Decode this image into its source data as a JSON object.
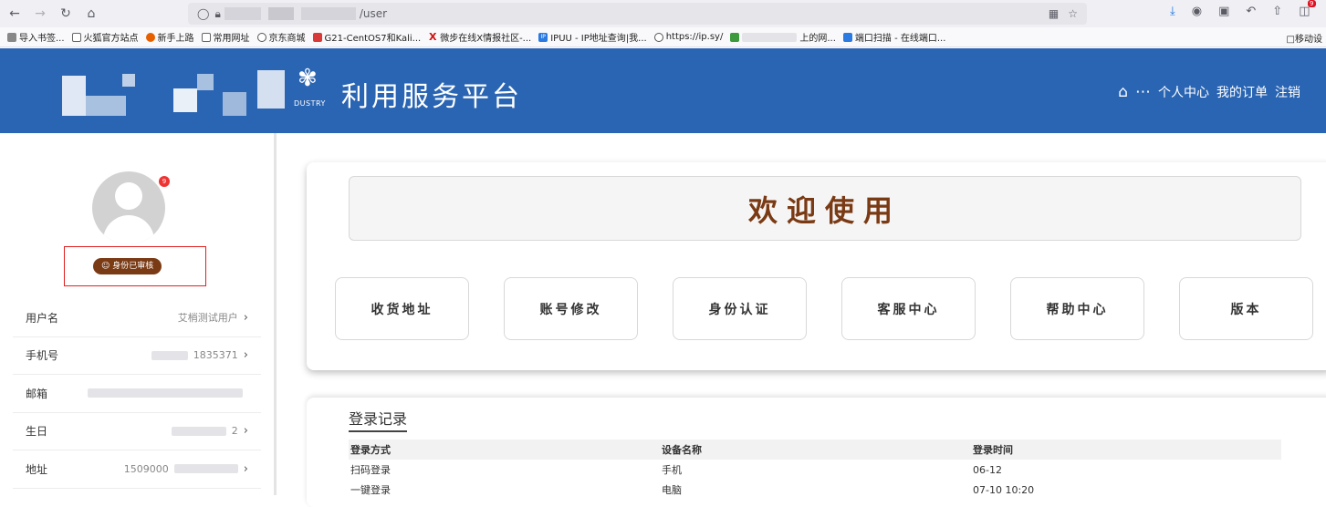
{
  "browser": {
    "address_path": "/user",
    "bookmarks": [
      {
        "label": "导入书签...",
        "icon": "import-icon",
        "color": "#888888"
      },
      {
        "label": "火狐官方站点",
        "icon": "folder-icon",
        "color": "#888888"
      },
      {
        "label": "新手上路",
        "icon": "firefox-icon",
        "color": "#e66000"
      },
      {
        "label": "常用网址",
        "icon": "folder-icon",
        "color": "#888888"
      },
      {
        "label": "京东商城",
        "icon": "globe-icon",
        "color": "#555555"
      },
      {
        "label": "G21-CentOS7和Kali...",
        "icon": "shield-icon",
        "color": "#d83a3a"
      },
      {
        "label": "微步在线X情报社区-...",
        "icon": "x-icon",
        "color": "#d01010"
      },
      {
        "label": "IPUU - IP地址查询|我...",
        "icon": "ip-icon",
        "color": "#2a7ae2"
      },
      {
        "label": "https://ip.sy/",
        "icon": "globe-icon",
        "color": "#555555"
      },
      {
        "label": "上的网...",
        "icon": "map-icon",
        "color": "#3c9a3c"
      },
      {
        "label": "端口扫描 - 在线端口...",
        "icon": "scan-icon",
        "color": "#2a7ae2"
      }
    ],
    "bookmarks_right": "移动设"
  },
  "header": {
    "title": "利用服务平台",
    "logo_sub": "DUSTRY",
    "nav": {
      "home_icon": "home-icon",
      "more_icon": "more-icon",
      "personal_center": "个人中心",
      "my_orders": "我的订单",
      "logout": "注销"
    }
  },
  "profile": {
    "verified_label": "身份已审核",
    "notification_count": "9",
    "fields": [
      {
        "label": "用户名",
        "value": "艾梢测试用户"
      },
      {
        "label": "手机号",
        "value": "1835371"
      },
      {
        "label": "邮箱",
        "value": ""
      },
      {
        "label": "生日",
        "value": "2"
      },
      {
        "label": "地址",
        "value": "1509000"
      }
    ]
  },
  "welcome": {
    "banner": "欢迎使用",
    "buttons": [
      "收货地址",
      "账号修改",
      "身份认证",
      "客服中心",
      "帮助中心",
      "版本"
    ]
  },
  "login_log": {
    "title": "登录记录",
    "columns": [
      "登录方式",
      "设备名称",
      "登录时间"
    ],
    "rows": [
      [
        "扫码登录",
        "手机",
        "06-12"
      ],
      [
        "一键登录",
        "电脑",
        "07-10 10:20"
      ]
    ]
  }
}
